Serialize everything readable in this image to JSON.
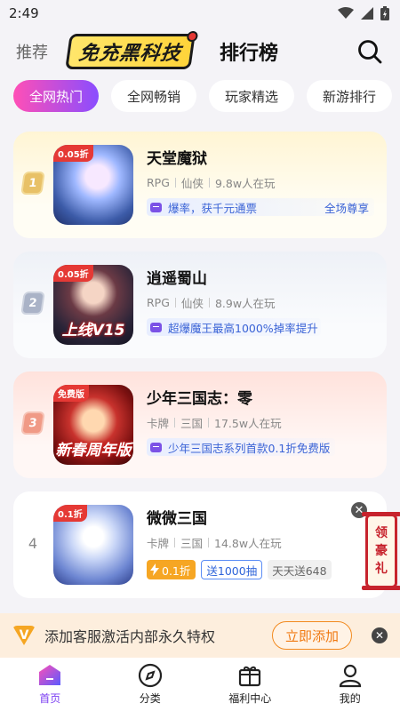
{
  "status_bar": {
    "time": "2:49"
  },
  "top_nav": {
    "recommend_label": "推荐",
    "logo_text": "免充黑科技",
    "rank_label": "排行榜",
    "search_icon": "search-icon"
  },
  "tabs": [
    "全网热门",
    "全网畅销",
    "玩家精选",
    "新游排行"
  ],
  "games": [
    {
      "rank": "1",
      "name": "天堂魔狱",
      "category": "RPG",
      "genre": "仙侠",
      "players": "9.8w人在玩",
      "badge": "0.05折",
      "caption": "",
      "promo": "爆率，获千元通票",
      "promo_right": "全场尊享"
    },
    {
      "rank": "2",
      "name": "逍遥蜀山",
      "category": "RPG",
      "genre": "仙侠",
      "players": "8.9w人在玩",
      "badge": "0.05折",
      "caption": "上线V15",
      "promo": "超爆魔王最高1000%掉率提升",
      "promo_right": ""
    },
    {
      "rank": "3",
      "name": "少年三国志：零",
      "category": "卡牌",
      "genre": "三国",
      "players": "17.5w人在玩",
      "badge": "免费版",
      "caption": "新春周年版",
      "promo": "少年三国志系列首款0.1折免费版",
      "promo_right": ""
    },
    {
      "rank": "4",
      "name": "微微三国",
      "category": "卡牌",
      "genre": "三国",
      "players": "14.8w人在玩",
      "badge": "0.1折",
      "caption": "",
      "tag_discount": "0.1折",
      "tag_draw": "送1000抽",
      "tag_daily": "天天送648"
    }
  ],
  "floating_gift": {
    "line1": "领",
    "line2": "豪",
    "line3": "礼"
  },
  "banner": {
    "text": "添加客服激活内部永久特权",
    "button": "立即添加",
    "vip_letter": "V"
  },
  "bottom_nav": [
    "首页",
    "分类",
    "福利中心",
    "我的"
  ],
  "colors": {
    "accent": "#7c3ff2",
    "tab_gradient_start": "#ff4fb6",
    "tab_gradient_end": "#8a4dff",
    "promo_text": "#3a63d6",
    "banner_bg": "#fdeedd",
    "banner_button": "#f07a12"
  }
}
